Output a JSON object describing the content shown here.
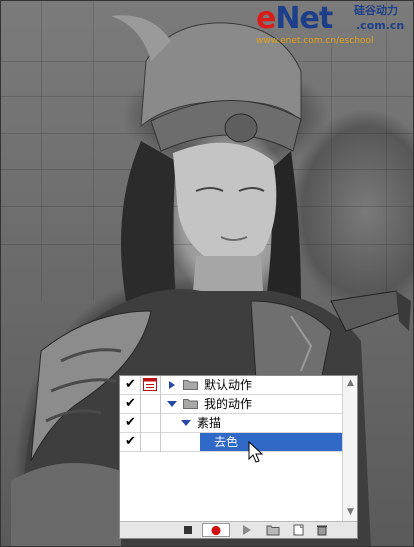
{
  "watermark": {
    "brand_e": "e",
    "brand_net": "Net",
    "brand_cn": "硅谷动力",
    "brand_com": ".com.cn",
    "url": "www.enet.com.cn/eschool"
  },
  "actions_panel": {
    "rows": [
      {
        "label": "默认动作",
        "type": "set",
        "expanded": false,
        "checked": true,
        "dialog": true,
        "selected": false
      },
      {
        "label": "我的动作",
        "type": "set",
        "expanded": true,
        "checked": true,
        "dialog": false,
        "selected": false
      },
      {
        "label": "素描",
        "type": "action",
        "expanded": true,
        "checked": true,
        "dialog": false,
        "selected": false
      },
      {
        "label": "去色",
        "type": "step",
        "checked": true,
        "dialog": false,
        "selected": true
      }
    ],
    "toolbar": {
      "buttons": [
        "stop-icon",
        "record-icon",
        "play-icon",
        "new-set-icon",
        "new-action-icon",
        "delete-icon"
      ]
    },
    "colors": {
      "selection": "#3169c6",
      "record": "#d01010",
      "triangle": "#2748a5"
    }
  }
}
